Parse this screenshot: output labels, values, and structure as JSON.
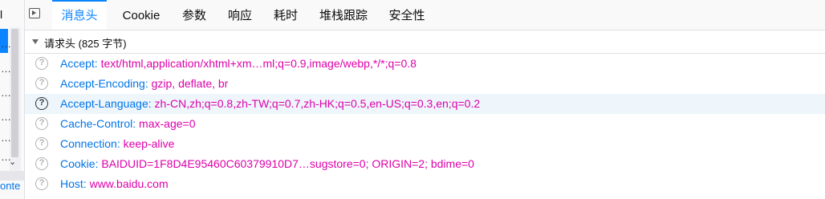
{
  "left_panel": {
    "top_char": "l",
    "ellipses": [
      "…",
      "…",
      "…",
      "…",
      "…",
      "…"
    ],
    "scroll_down_icon": "chevron-down-icon",
    "bottom_text": "onte"
  },
  "tabs": [
    {
      "label": "消息头",
      "active": true
    },
    {
      "label": "Cookie",
      "active": false
    },
    {
      "label": "参数",
      "active": false
    },
    {
      "label": "响应",
      "active": false
    },
    {
      "label": "耗时",
      "active": false
    },
    {
      "label": "堆栈跟踪",
      "active": false
    },
    {
      "label": "安全性",
      "active": false
    }
  ],
  "section": {
    "title": "请求头 (825 字节)"
  },
  "headers": [
    {
      "key": "Accept:",
      "value": "text/html,application/xhtml+xm…ml;q=0.9,image/webp,*/*;q=0.8"
    },
    {
      "key": "Accept-Encoding:",
      "value": "gzip, deflate, br"
    },
    {
      "key": "Accept-Language:",
      "value": "zh-CN,zh;q=0.8,zh-TW;q=0.7,zh-HK;q=0.5,en-US;q=0.3,en;q=0.2"
    },
    {
      "key": "Cache-Control:",
      "value": "max-age=0"
    },
    {
      "key": "Connection:",
      "value": "keep-alive"
    },
    {
      "key": "Cookie:",
      "value": "BAIDUID=1F8D4E95460C60379910D7…sugstore=0; ORIGIN=2; bdime=0"
    },
    {
      "key": "Host:",
      "value": "www.baidu.com"
    }
  ],
  "help_icon_glyph": "?",
  "colors": {
    "accent": "#0a84ff",
    "header_key": "#0074e8",
    "header_value": "#dd00a9",
    "hover_row": "#eef6fc"
  }
}
